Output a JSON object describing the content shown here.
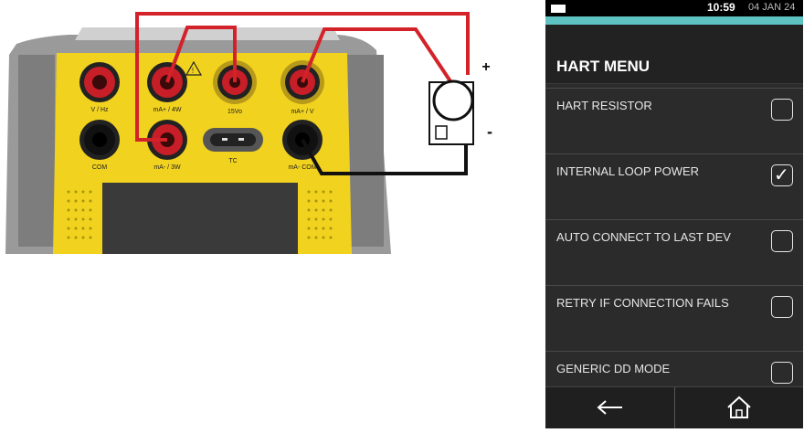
{
  "diagram": {
    "terminal_labels": {
      "v_hz": "V / Hz",
      "com": "COM",
      "ma_4w": "mA+ / 4W",
      "ma_3w": "mA- / 3W",
      "vdc": "15Vo",
      "ma_v": "mA+ / V",
      "ma_com": "mA- COM",
      "tc": "TC"
    },
    "plus_sign": "+",
    "minus_sign": "-",
    "colors": {
      "yellow": "#f1d21e",
      "wire": "#d4222a",
      "grey": "#8e8e8e"
    }
  },
  "device": {
    "status": {
      "time": "10:59",
      "date": "04 JAN 24"
    },
    "title": "HART MENU",
    "items": [
      {
        "label": "HART RESISTOR",
        "checked": false
      },
      {
        "label": "INTERNAL LOOP POWER",
        "checked": true
      },
      {
        "label": "AUTO CONNECT TO LAST DEV",
        "checked": false
      },
      {
        "label": "RETRY IF CONNECTION FAILS",
        "checked": false
      },
      {
        "label": "GENERIC DD MODE",
        "checked": false
      }
    ],
    "nav": {
      "back_icon": "←",
      "home_icon": "home-icon"
    },
    "colors": {
      "accent": "#5ec2c2",
      "background": "#2b2b2b"
    }
  }
}
